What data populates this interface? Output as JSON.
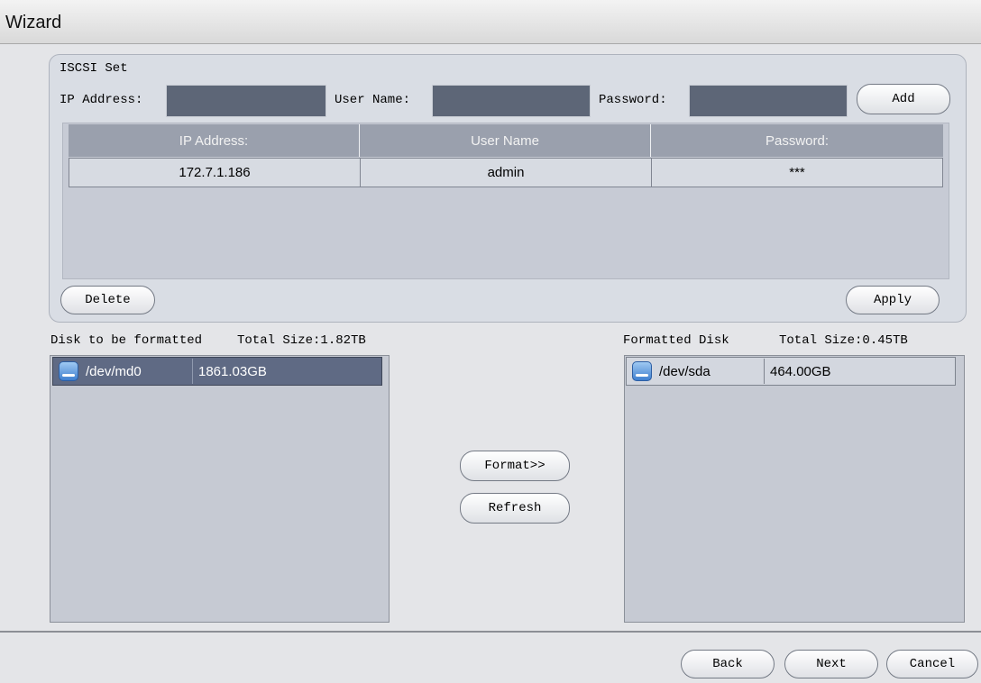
{
  "window": {
    "title": "Wizard"
  },
  "iscsi": {
    "group_label": "ISCSI Set",
    "ip_label": "IP Address:",
    "ip_value": "",
    "user_label": "User Name:",
    "user_value": "",
    "password_label": "Password:",
    "password_value": "",
    "add_button": "Add",
    "delete_button": "Delete",
    "apply_button": "Apply",
    "table": {
      "headers": [
        "IP Address:",
        "User Name",
        "Password:"
      ],
      "rows": [
        [
          "172.7.1.186",
          "admin",
          "***"
        ]
      ]
    }
  },
  "disks": {
    "left_label": "Disk to be formatted",
    "left_total": "Total Size:1.82TB",
    "left_items": [
      {
        "name": "/dev/md0",
        "size": "1861.03GB",
        "icon": "hard-disk-icon"
      }
    ],
    "right_label": "Formatted Disk",
    "right_total": "Total Size:0.45TB",
    "right_items": [
      {
        "name": "/dev/sda",
        "size": "464.00GB",
        "icon": "hard-disk-icon"
      }
    ],
    "format_button": "Format>>",
    "refresh_button": "Refresh"
  },
  "footer": {
    "back": "Back",
    "next": "Next",
    "cancel": "Cancel"
  },
  "colors": {
    "field_bg": "#5d6677",
    "header_bg": "#9aa0ad",
    "selected_row": "#5f6a84"
  }
}
